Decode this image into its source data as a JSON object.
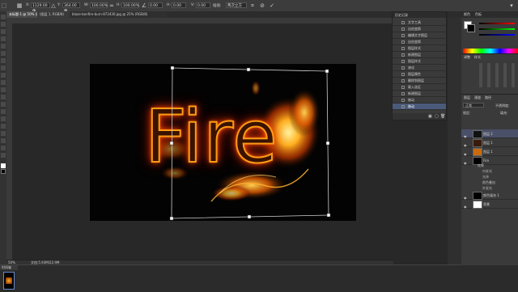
{
  "options_bar": {
    "x_value": "1129.00 像",
    "y_value": "364.00 像",
    "w_value": "100.00%",
    "h_value": "100.00%",
    "angle_value": "0.00",
    "h_skew_value": "0.00",
    "v_skew_value": "0.00",
    "interpolation_label": "插值:",
    "interpolation_value": "两次立方"
  },
  "tabs": [
    {
      "label": "未标题-1 @ 50% (图层 1, RGB/8)"
    },
    {
      "label": "(图层 1, RGB/8)"
    },
    {
      "label": "blaze-bonfire-burn-872430.jpg @ 25% (RGB/8)"
    }
  ],
  "history": {
    "title": "历史记录",
    "items": [
      "文字工具",
      "自由变换",
      "编辑文字图层",
      "自由变换",
      "图层样式",
      "新建图层",
      "图层样式",
      "液化",
      "图层属性",
      "删除到图层",
      "载入选区",
      "新建图层",
      "移动",
      "移动"
    ]
  },
  "canvas": {
    "fire_text": "Fire"
  },
  "status": {
    "zoom": "50%",
    "doc_info": "文档:5.93M/22.9M"
  },
  "right_panel": {
    "tabs": [
      "颜色",
      "色板"
    ],
    "adjust_tabs": [
      "调整",
      "样式"
    ],
    "layers_tabs": [
      "图层",
      "通道",
      "路径"
    ],
    "blend_mode": "正常",
    "opacity_label": "不透明度:",
    "fill_label": "填充:",
    "lock_label": "锁定:",
    "layers": [
      {
        "name": "图层 2",
        "selected": true
      },
      {
        "name": "图层 1",
        "selected": false
      },
      {
        "name": "图层 1",
        "selected": false
      },
      {
        "name": "Fire",
        "selected": false
      },
      {
        "name": "颜色填充 1",
        "selected": false
      },
      {
        "name": "背景",
        "selected": false
      }
    ],
    "effects": [
      "效果",
      "内发光",
      "光泽",
      "颜色叠加",
      "外发光"
    ]
  },
  "timeline": {
    "label": "时间轴"
  },
  "colors": {
    "ui_bg": "#282828",
    "panel": "#3a3a3a",
    "fire_stroke": "#ff9a14",
    "selection": "#4a5a7a"
  }
}
